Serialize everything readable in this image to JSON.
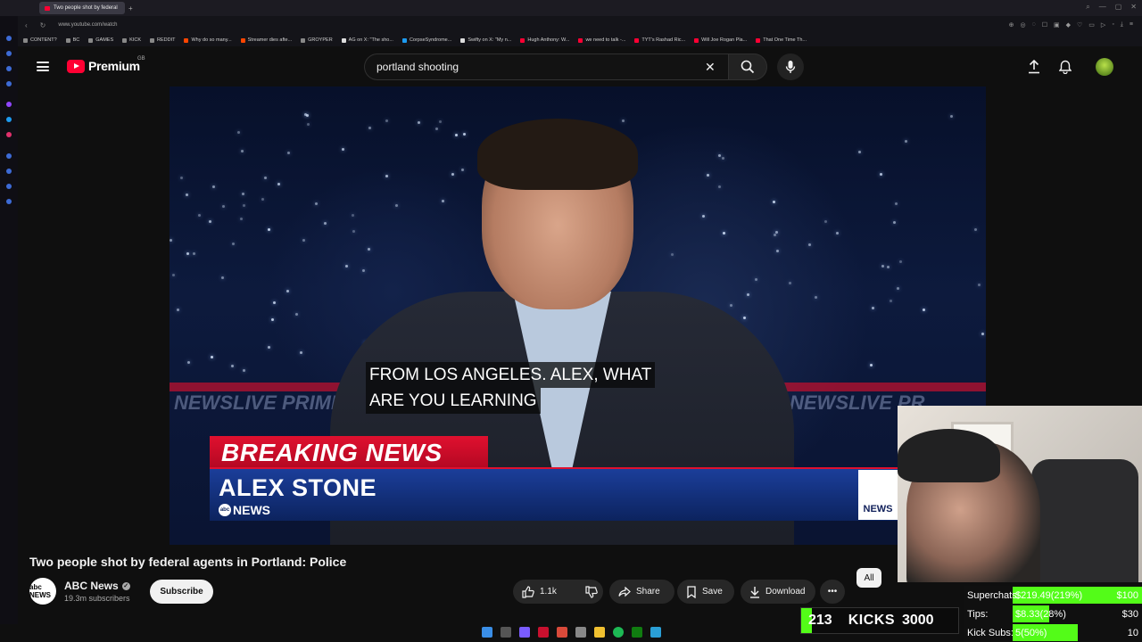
{
  "browser": {
    "tab_title": "Two people shot by federal",
    "url": "www.youtube.com/watch",
    "bookmarks": [
      {
        "label": "CONTENT?",
        "color": "#888888"
      },
      {
        "label": "BC",
        "color": "#888888"
      },
      {
        "label": "GAMES",
        "color": "#888888"
      },
      {
        "label": "KICK",
        "color": "#888888"
      },
      {
        "label": "REDDIT",
        "color": "#888888"
      },
      {
        "label": "Why do so many...",
        "color": "#ff4500"
      },
      {
        "label": "Streamer dies afte...",
        "color": "#ff4500"
      },
      {
        "label": "GROYPER",
        "color": "#888888"
      },
      {
        "label": "AG on X: \"The sho...",
        "color": "#dddddd"
      },
      {
        "label": "CorpseSyndrome...",
        "color": "#1d9bf0"
      },
      {
        "label": "Swifty on X: \"My n...",
        "color": "#dddddd"
      },
      {
        "label": "Hugh Anthony: W...",
        "color": "#ff0033"
      },
      {
        "label": "we need to talk -...",
        "color": "#ff0033"
      },
      {
        "label": "TYT's Rashad Ric...",
        "color": "#ff0033"
      },
      {
        "label": "Will Joe Rogan Pla...",
        "color": "#ff0033"
      },
      {
        "label": "That One Time Th...",
        "color": "#ff0033"
      }
    ]
  },
  "header": {
    "logo_text": "Premium",
    "country_code": "GB",
    "search_query": "portland shooting"
  },
  "video": {
    "caption_line1": "FROM LOS ANGELES. ALEX, WHAT",
    "caption_line2": "ARE YOU LEARNING",
    "breaking_label": "BREAKING NEWS",
    "anchor_name": "ALEX STONE",
    "network_label": "NEWS",
    "network_abc": "abc",
    "bg_text_left": "NEWSLIVE PRIME",
    "bg_text_right": "NEWSLIVE PR",
    "bug_label": "NEWS"
  },
  "watch": {
    "title": "Two people shot by federal agents in Portland: Police",
    "channel_name": "ABC News",
    "channel_avatar_text": "abc NEWS",
    "subscribers": "19.3m subscribers",
    "subscribe_label": "Subscribe",
    "likes": "1.1k",
    "share_label": "Share",
    "save_label": "Save",
    "download_label": "Download",
    "chip_all": "All"
  },
  "overlays": {
    "kicks_count": "213",
    "kicks_label": "KICKS",
    "kicks_goal": "3000",
    "kicks_progress": 0.071,
    "goals": [
      {
        "label": "Superchats:",
        "value": "$219.49(219%)",
        "target": "$100",
        "progress": 1.0
      },
      {
        "label": "Tips:",
        "value": "$8.33(28%)",
        "target": "$30",
        "progress": 0.28
      },
      {
        "label": "Kick Subs:",
        "value": "5(50%)",
        "target": "10",
        "progress": 0.5
      }
    ]
  },
  "colors": {
    "youtube_red": "#ff0033",
    "breaking_red": "#e0102f",
    "kick_green": "#53fc18",
    "background": "#0f0f0f"
  }
}
